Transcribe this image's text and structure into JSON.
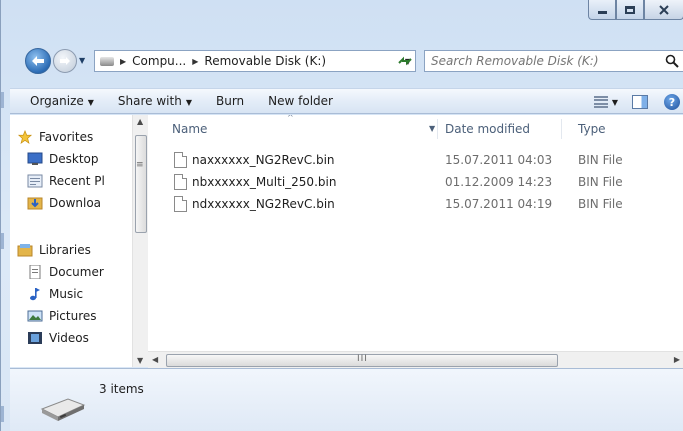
{
  "window": {
    "caption": {
      "minimize": "minimize",
      "maximize": "maximize",
      "close": "close"
    }
  },
  "address": {
    "crumbs": [
      "Compu...",
      "Removable Disk (K:)"
    ],
    "search_placeholder": "Search Removable Disk (K:)"
  },
  "toolbar": {
    "organize": "Organize",
    "share_with": "Share with",
    "burn": "Burn",
    "new_folder": "New folder"
  },
  "nav": {
    "favorites_label": "Favorites",
    "favorites": [
      "Desktop",
      "Recent Pl",
      "Downloa"
    ],
    "libraries_label": "Libraries",
    "libraries": [
      "Documer",
      "Music",
      "Pictures",
      "Videos"
    ]
  },
  "columns": {
    "name": "Name",
    "date": "Date modified",
    "type": "Type"
  },
  "files": [
    {
      "name": "naxxxxxx_NG2RevC.bin",
      "date": "15.07.2011 04:03",
      "type": "BIN File"
    },
    {
      "name": "nbxxxxxx_Multi_250.bin",
      "date": "01.12.2009 14:23",
      "type": "BIN File"
    },
    {
      "name": "ndxxxxxx_NG2RevC.bin",
      "date": "15.07.2011 04:19",
      "type": "BIN File"
    }
  ],
  "status": {
    "item_count": "3 items"
  },
  "colors": {
    "accent": "#1f4f8c",
    "selection": "#dce9f7"
  }
}
